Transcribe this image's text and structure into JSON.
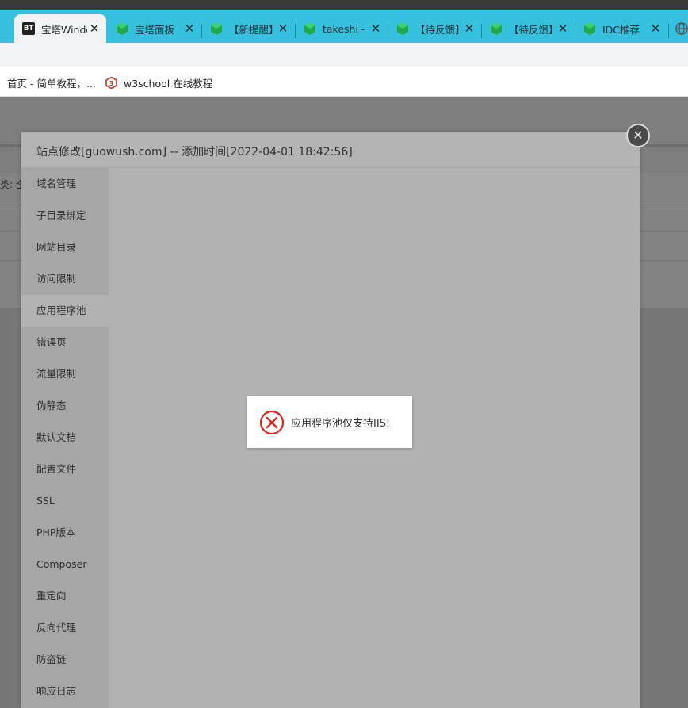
{
  "browser": {
    "tabs": [
      {
        "label": "宝塔Windows",
        "icon": "bt-logo-icon"
      },
      {
        "label": "宝塔面板",
        "icon": "bt-cube-icon"
      },
      {
        "label": "【新提醒】",
        "icon": "bt-cube-icon"
      },
      {
        "label": "takeshi -",
        "icon": "bt-cube-icon"
      },
      {
        "label": "【待反馈】",
        "icon": "bt-cube-icon"
      },
      {
        "label": "【待反馈】",
        "icon": "bt-cube-icon"
      },
      {
        "label": "IDC推荐",
        "icon": "bt-cube-icon"
      }
    ],
    "bt_icon_text": "BT",
    "close_glyph": "✕",
    "bookmarks": [
      {
        "label": "首页 - 简单教程，..."
      },
      {
        "label": "w3school 在线教程",
        "icon": "w3school-icon"
      }
    ]
  },
  "page": {
    "fragment": "类: 全"
  },
  "modal": {
    "title": "站点修改[guowush.com] -- 添加时间[2022-04-01 18:42:56]",
    "close_glyph": "✕",
    "sidebar": [
      {
        "label": "域名管理"
      },
      {
        "label": "子目录绑定"
      },
      {
        "label": "网站目录"
      },
      {
        "label": "访问限制"
      },
      {
        "label": "应用程序池",
        "active": true
      },
      {
        "label": "错误页"
      },
      {
        "label": "流量限制"
      },
      {
        "label": "伪静态"
      },
      {
        "label": "默认文档"
      },
      {
        "label": "配置文件"
      },
      {
        "label": "SSL"
      },
      {
        "label": "PHP版本"
      },
      {
        "label": "Composer"
      },
      {
        "label": "重定向"
      },
      {
        "label": "反向代理"
      },
      {
        "label": "防盗链"
      },
      {
        "label": "响应日志"
      }
    ]
  },
  "toast": {
    "message": "应用程序池仅支持IIS!",
    "icon": "error-circle-icon",
    "icon_color": "#e2231a"
  },
  "colors": {
    "tabstrip": "#35c0de",
    "overlay_modal": "#b2b2b2",
    "sidebar_bg": "#a6a6a6"
  }
}
